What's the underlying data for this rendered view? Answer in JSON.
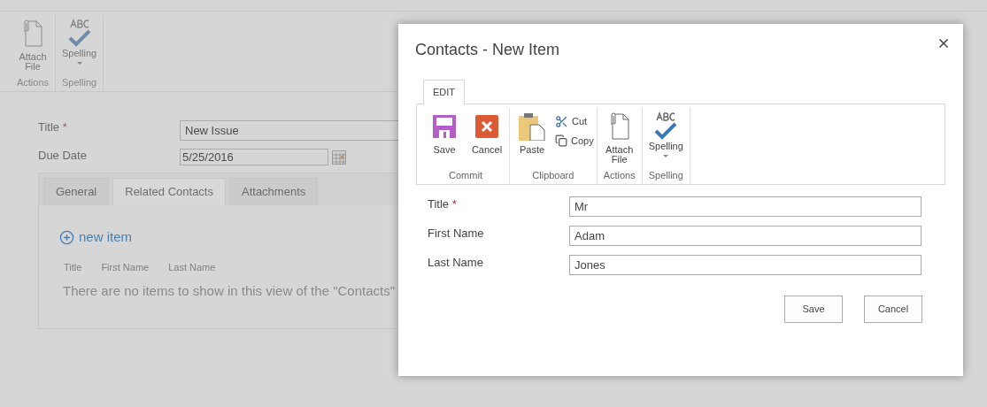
{
  "background_page": {
    "ribbon_groups": [
      {
        "label": "Actions",
        "buttons": [
          {
            "kind": "attach",
            "label": "Attach File"
          }
        ]
      },
      {
        "label": "Spelling",
        "buttons": [
          {
            "kind": "spelling",
            "label": "Spelling"
          }
        ]
      }
    ],
    "fields": [
      {
        "kind": "text",
        "label": "Title",
        "required_mark": "*",
        "value": "New Issue"
      },
      {
        "kind": "date",
        "label": "Due Date",
        "value": "5/25/2016"
      }
    ],
    "tabs": [
      {
        "label": "General",
        "selected": false
      },
      {
        "label": "Related Contacts",
        "selected": true
      },
      {
        "label": "Attachments",
        "selected": false
      }
    ],
    "new_item_link": "new item",
    "columns": [
      "Title",
      "First Name",
      "Last Name"
    ],
    "empty_message": "There are no items to show in this view of the \"Contacts\""
  },
  "dialog": {
    "title": "Contacts - New Item",
    "ribbon_tabs": [
      {
        "label": "EDIT",
        "selected": true
      }
    ],
    "ribbon_groups": [
      {
        "label": "Commit",
        "buttons": [
          {
            "kind": "save",
            "label": "Save"
          },
          {
            "kind": "cancel",
            "label": "Cancel"
          }
        ]
      },
      {
        "label": "Clipboard",
        "buttons": [
          {
            "kind": "paste",
            "label": "Paste"
          },
          {
            "kind": "cut",
            "label": "Cut"
          },
          {
            "kind": "copy",
            "label": "Copy"
          }
        ]
      },
      {
        "label": "Actions",
        "buttons": [
          {
            "kind": "attach",
            "label": "Attach File"
          }
        ]
      },
      {
        "label": "Spelling",
        "buttons": [
          {
            "kind": "spelling",
            "label": "Spelling"
          }
        ]
      }
    ],
    "fields": [
      {
        "label": "Title",
        "required_mark": "*",
        "value": "Mr"
      },
      {
        "label": "First Name",
        "value": "Adam"
      },
      {
        "label": "Last Name",
        "value": "Jones"
      }
    ],
    "buttons": [
      "Save",
      "Cancel"
    ]
  }
}
